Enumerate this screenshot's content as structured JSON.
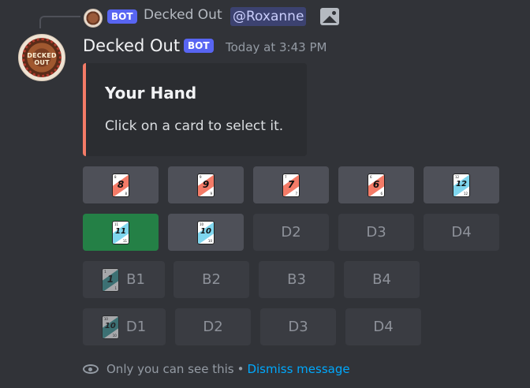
{
  "reply": {
    "bot_badge": "BOT",
    "author": "Decked Out",
    "mention": "@Roxanne"
  },
  "message": {
    "author": "Decked Out",
    "bot_badge": "BOT",
    "timestamp": "Today at 3:43 PM",
    "avatar_text": "DECKED OUT"
  },
  "embed": {
    "title": "Your Hand",
    "description": "Click on a card to select it.",
    "accent_color": "#f47b67"
  },
  "rows": [
    [
      {
        "card": "8",
        "color": "#f47b67",
        "label": "",
        "style": "secondary"
      },
      {
        "card": "9",
        "color": "#f47b67",
        "label": "",
        "style": "secondary"
      },
      {
        "card": "7",
        "color": "#f47b67",
        "label": "",
        "style": "secondary"
      },
      {
        "card": "6",
        "color": "#f47b67",
        "label": "",
        "style": "secondary"
      },
      {
        "card": "12",
        "color": "#7fd6ee",
        "label": "",
        "style": "secondary"
      }
    ],
    [
      {
        "card": "11",
        "color": "#7fd6ee",
        "label": "",
        "style": "success"
      },
      {
        "card": "10",
        "color": "#7fd6ee",
        "label": "",
        "style": "secondary"
      },
      {
        "card": "",
        "color": "",
        "label": "D2",
        "style": "disabled"
      },
      {
        "card": "",
        "color": "",
        "label": "D3",
        "style": "disabled"
      },
      {
        "card": "",
        "color": "",
        "label": "D4",
        "style": "disabled"
      }
    ],
    [
      {
        "card": "1",
        "color": "#3f9c9c",
        "label": "B1",
        "style": "disabled"
      },
      {
        "card": "",
        "color": "",
        "label": "B2",
        "style": "disabled"
      },
      {
        "card": "",
        "color": "",
        "label": "B3",
        "style": "disabled"
      },
      {
        "card": "",
        "color": "",
        "label": "B4",
        "style": "disabled"
      }
    ],
    [
      {
        "card": "10",
        "color": "#3f9c9c",
        "label": "D1",
        "style": "disabled"
      },
      {
        "card": "",
        "color": "",
        "label": "D2",
        "style": "disabled"
      },
      {
        "card": "",
        "color": "",
        "label": "D3",
        "style": "disabled"
      },
      {
        "card": "",
        "color": "",
        "label": "D4",
        "style": "disabled"
      }
    ]
  ],
  "footer": {
    "visibility": "Only you can see this",
    "separator": "•",
    "dismiss": "Dismiss message"
  }
}
